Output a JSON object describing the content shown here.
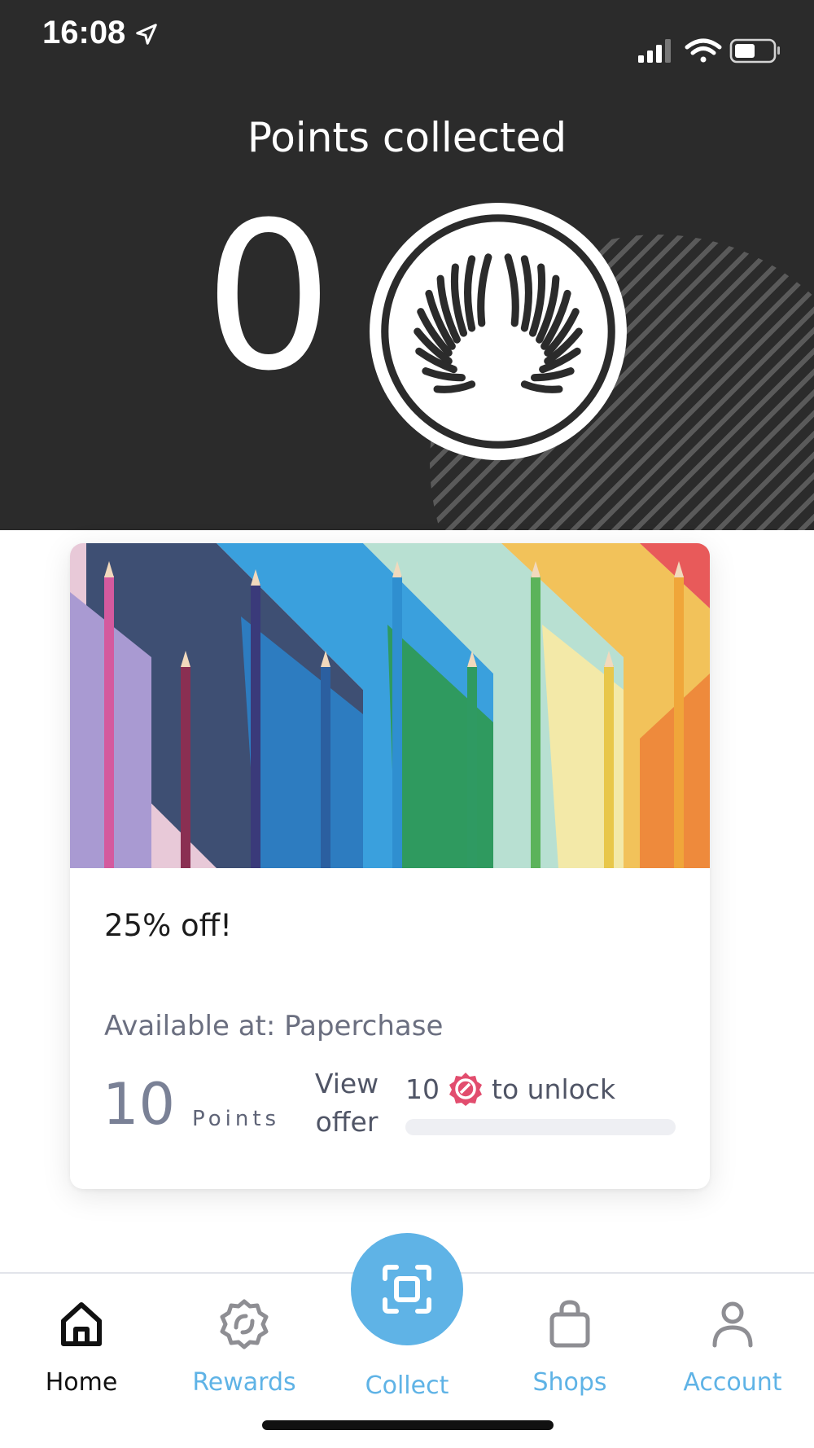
{
  "status_bar": {
    "time": "16:08",
    "icons": [
      "location-arrow-icon",
      "signal-icon",
      "wifi-icon",
      "battery-icon"
    ]
  },
  "header": {
    "title": "Points collected",
    "points": "0",
    "logo_icon": "wing-coin-logo"
  },
  "offer_card": {
    "title": "25% off!",
    "availability": "Available at: Paperchase",
    "points_cost": "10",
    "points_unit": "Points",
    "view_offer_line1": "View",
    "view_offer_line2": "offer",
    "unlock_amount": "10",
    "unlock_icon": "rewards-badge-icon",
    "unlock_text": "to unlock",
    "progress_fraction": 0.0,
    "image_description_icon": "colored-pencils-photo"
  },
  "nav": {
    "items": [
      {
        "label": "Home",
        "icon": "home-icon",
        "active": true
      },
      {
        "label": "Rewards",
        "icon": "rewards-badge-icon",
        "active": false
      },
      {
        "label": "Collect",
        "icon": "scan-icon",
        "active": false
      },
      {
        "label": "Shops",
        "icon": "shopping-bag-icon",
        "active": false
      },
      {
        "label": "Account",
        "icon": "person-icon",
        "active": false
      }
    ]
  },
  "colors": {
    "header_bg": "#2b2b2b",
    "accent_blue": "#5fb3e6",
    "active_nav": "#111111",
    "muted_text": "#6b6f80",
    "badge_pink": "#e24d6e"
  }
}
